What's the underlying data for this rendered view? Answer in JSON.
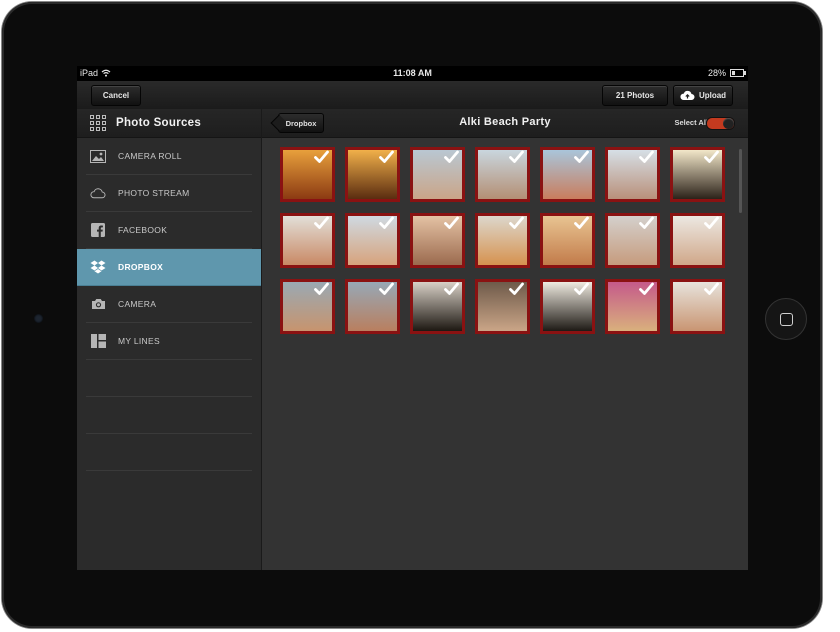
{
  "status_bar": {
    "device": "iPad",
    "time": "11:08 AM",
    "battery": "28%"
  },
  "nav": {
    "cancel_label": "Cancel",
    "photos_label": "21 Photos",
    "upload_label": "Upload"
  },
  "sidebar": {
    "title": "Photo Sources",
    "items": [
      {
        "label": "CAMERA ROLL",
        "icon": "image-icon",
        "active": false
      },
      {
        "label": "PHOTO STREAM",
        "icon": "cloud-icon",
        "active": false
      },
      {
        "label": "FACEBOOK",
        "icon": "facebook-icon",
        "active": false
      },
      {
        "label": "DROPBOX",
        "icon": "dropbox-icon",
        "active": true
      },
      {
        "label": "CAMERA",
        "icon": "camera-icon",
        "active": false
      },
      {
        "label": "MY LINES",
        "icon": "layout-icon",
        "active": false
      }
    ]
  },
  "content": {
    "back_label": "Dropbox",
    "album_title": "Alki Beach Party",
    "select_all_label": "Select All",
    "select_all_on": true
  },
  "colors": {
    "accent_sidebar_active": "#5f97ad",
    "photo_border": "#8a1212",
    "toggle_on": "#c33a1f"
  },
  "photos": [
    {
      "bg": "linear-gradient(#e8a03c,#8b3a12)",
      "selected": true
    },
    {
      "bg": "linear-gradient(#f1b04a,#5a2c10)",
      "selected": true
    },
    {
      "bg": "linear-gradient(#b9c7d2,#caa588)",
      "selected": true
    },
    {
      "bg": "linear-gradient(#c9d6de,#b48f74)",
      "selected": true
    },
    {
      "bg": "linear-gradient(#a9c5da,#c97d5d)",
      "selected": true
    },
    {
      "bg": "linear-gradient(#d6dfe6,#b9907a)",
      "selected": true
    },
    {
      "bg": "linear-gradient(#f2e7c9,#2c2219)",
      "selected": true
    },
    {
      "bg": "linear-gradient(#e2dfd8,#c98965)",
      "selected": true
    },
    {
      "bg": "linear-gradient(#cfd9e1,#d7a37c)",
      "selected": true
    },
    {
      "bg": "linear-gradient(#e4c2a4,#9b6a4e)",
      "selected": true
    },
    {
      "bg": "linear-gradient(#dcd7cc,#d6924f)",
      "selected": true
    },
    {
      "bg": "linear-gradient(#e8c492,#c27b4a)",
      "selected": true
    },
    {
      "bg": "linear-gradient(#d4d0cc,#c69b7d)",
      "selected": true
    },
    {
      "bg": "linear-gradient(#ece8e2,#d0a789)",
      "selected": true
    },
    {
      "bg": "linear-gradient(#9aa9b3,#c7946e)",
      "selected": true
    },
    {
      "bg": "linear-gradient(#97a8b6,#b97f5f)",
      "selected": true
    },
    {
      "bg": "linear-gradient(#d8d0c6,#1d1812)",
      "selected": true
    },
    {
      "bg": "linear-gradient(#6e5a4a,#caa587)",
      "selected": true
    },
    {
      "bg": "linear-gradient(#efeae0,#1e1a15)",
      "selected": true
    },
    {
      "bg": "linear-gradient(#c55a8a,#d9b07d)",
      "selected": true
    },
    {
      "bg": "linear-gradient(#e7e3dc,#c99572)",
      "selected": true
    }
  ]
}
